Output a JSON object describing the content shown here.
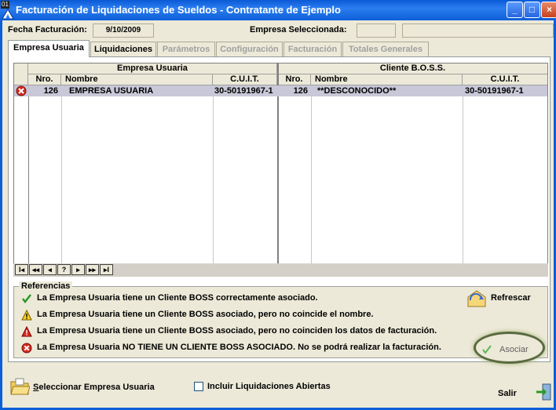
{
  "window": {
    "id_badge": "01",
    "title": "Facturación de Liquidaciones de Sueldos - Contratante de Ejemplo",
    "minimize": "_",
    "maximize": "□",
    "close": "×"
  },
  "header": {
    "fecha_label": "Fecha Facturación:",
    "fecha_value": "9/10/2009",
    "empresa_label": "Empresa Seleccionada:",
    "empresa_code": "",
    "empresa_name": ""
  },
  "tabs": [
    {
      "label": "Empresa Usuaria",
      "state": "active"
    },
    {
      "label": "Liquidaciones",
      "state": "enabled"
    },
    {
      "label": "Parámetros",
      "state": "disabled"
    },
    {
      "label": "Configuración",
      "state": "disabled"
    },
    {
      "label": "Facturación",
      "state": "disabled"
    },
    {
      "label": "Totales Generales",
      "state": "disabled"
    }
  ],
  "grid": {
    "group_left": "Empresa Usuaria",
    "group_right": "Cliente B.O.S.S.",
    "columns": [
      "Nro.",
      "Nombre",
      "C.U.I.T.",
      "Nro.",
      "Nombre",
      "C.U.I.T."
    ],
    "rows": [
      {
        "status": "error",
        "emp_nro": "126",
        "emp_nombre": "EMPRESA USUARIA",
        "emp_cuit": "30-50191967-1",
        "cli_nro": "126",
        "cli_nombre": "**DESCONOCIDO**",
        "cli_cuit": "30-50191967-1"
      }
    ]
  },
  "navigator": [
    "I◂",
    "◂◂",
    "◂",
    "?",
    "▸",
    "▸▸",
    "▸I"
  ],
  "referencias": {
    "title": "Referencias",
    "items": [
      {
        "icon": "check-icon",
        "text": "La Empresa Usuaria tiene un Cliente BOSS correctamente asociado."
      },
      {
        "icon": "warning-yellow-icon",
        "text": "La Empresa Usuaria tiene un Cliente BOSS asociado, pero no coincide el nombre."
      },
      {
        "icon": "warning-red-icon",
        "text": "La Empresa Usuaria tiene un Cliente BOSS asociado, pero no coinciden los datos de facturación."
      },
      {
        "icon": "error-icon",
        "text": "La Empresa Usuaria NO TIENE UN CLIENTE BOSS ASOCIADO. No se podrá realizar la facturación."
      }
    ],
    "refrescar": "Refrescar",
    "asociar": "Asociar"
  },
  "footer": {
    "seleccionar": "Seleccionar Empresa Usuaria",
    "incluir": "Incluir Liquidaciones Abiertas",
    "salir": "Salir"
  }
}
